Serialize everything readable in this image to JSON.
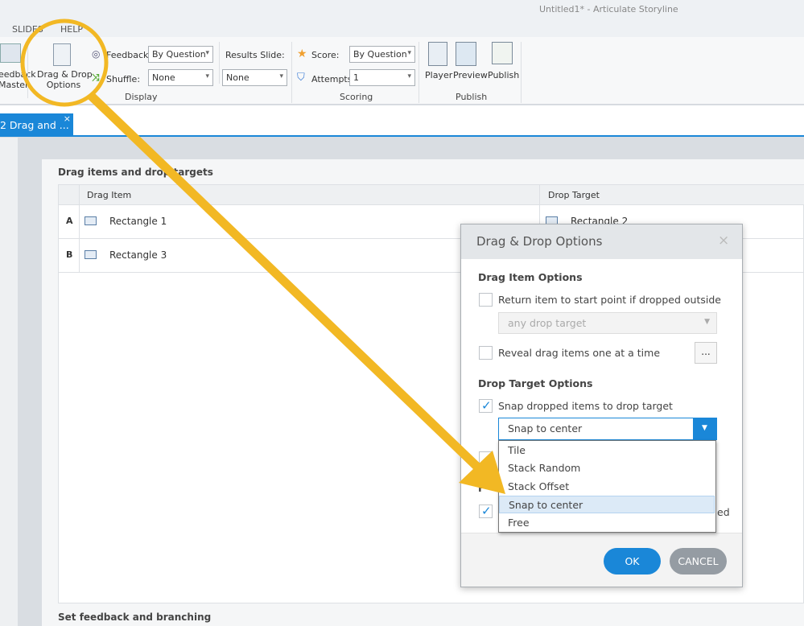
{
  "window": {
    "title": "Untitled1* -  Articulate Storyline"
  },
  "ribbon_tabs": [
    "SLIDES",
    "HELP"
  ],
  "ribbon": {
    "feedback_master": "eedback\nMaster",
    "drag_drop_options": "Drag & Drop\nOptions",
    "feedback_label": "Feedback:",
    "feedback_value": "By Question",
    "shuffle_label": "Shuffle:",
    "shuffle_value": "None",
    "results_slide_label": "Results Slide:",
    "results_slide_value": "None",
    "display_group": "Display",
    "score_label": "Score:",
    "score_value": "By Question",
    "attempts_label": "Attempts:",
    "attempts_value": "1",
    "scoring_group": "Scoring",
    "player": "Player",
    "preview": "Preview",
    "publish": "Publish",
    "publish_group": "Publish"
  },
  "doc_tab": {
    "label": "2 Drag and ...",
    "close": "×"
  },
  "panel": {
    "section_title": "Drag items and drop targets",
    "columns": [
      "Drag Item",
      "Drop Target"
    ],
    "rows": [
      {
        "key": "A",
        "item": "Rectangle 1",
        "target": "Rectangle 2"
      },
      {
        "key": "B",
        "item": "Rectangle 3",
        "target": ""
      }
    ],
    "feedback_title": "Set feedback and branching"
  },
  "dialog": {
    "title": "Drag & Drop Options",
    "close": "×",
    "drag_item_heading": "Drag Item Options",
    "return_item": "Return item to start point if dropped outside",
    "return_item_checked": false,
    "return_target": "any drop target",
    "reveal_items": "Reveal drag items one at a time",
    "reveal_checked": false,
    "more_button": "...",
    "drop_target_heading": "Drop Target Options",
    "snap_items": "Snap dropped items to drop target",
    "snap_checked": true,
    "snap_value": "Snap to center",
    "snap_options": [
      "Tile",
      "Stack Random",
      "Stack Offset",
      "Snap to center",
      "Free"
    ],
    "snap_selected_index": 3,
    "hidden_heading_fragment": "F",
    "hidden_option_fragment": "ed",
    "ok": "OK",
    "cancel": "CANCEL"
  },
  "colors": {
    "accent": "#1a87d8",
    "annotation": "#f2b824"
  }
}
